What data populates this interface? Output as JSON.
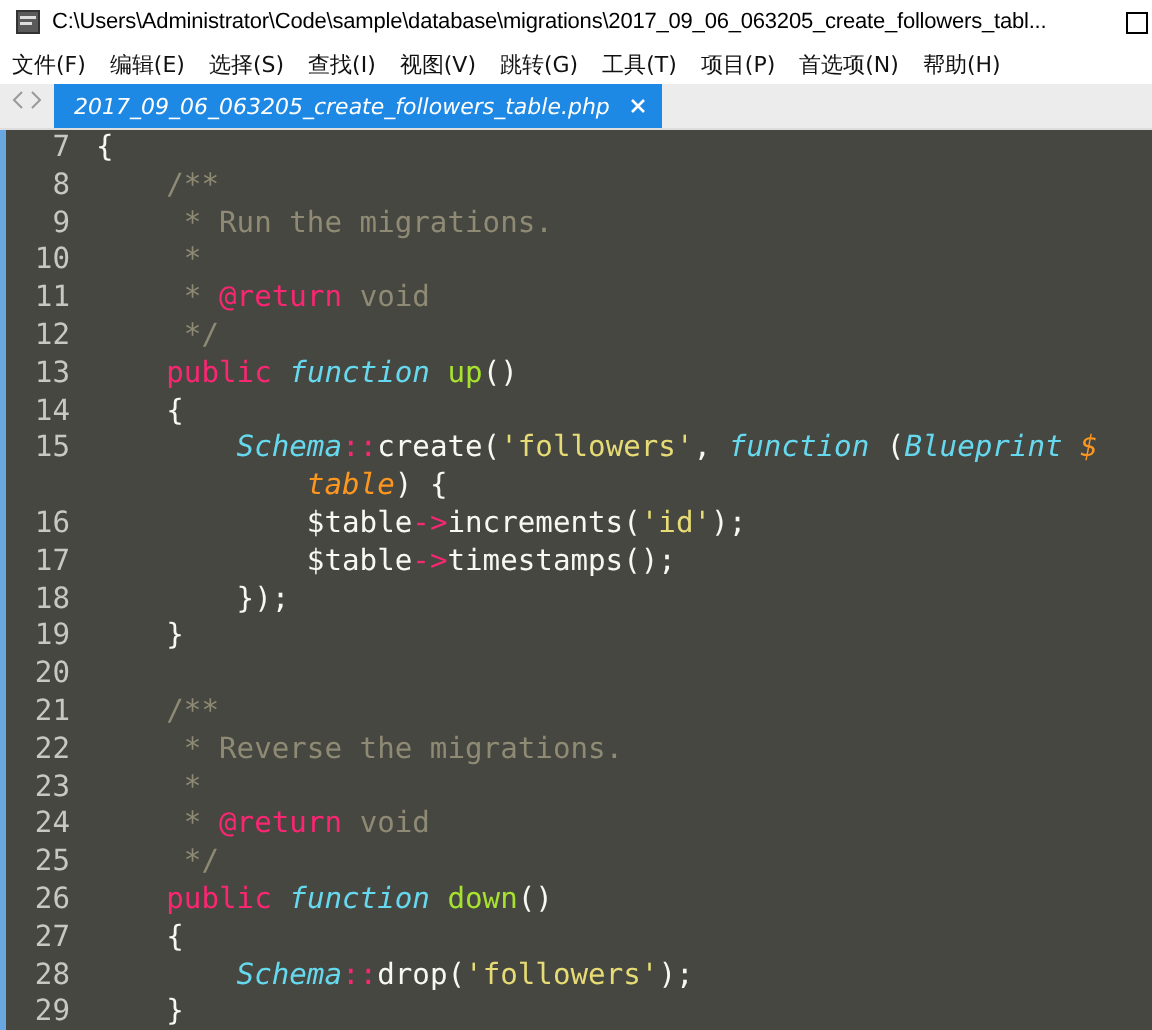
{
  "window": {
    "title": "C:\\Users\\Administrator\\Code\\sample\\database\\migrations\\2017_09_06_063205_create_followers_tabl..."
  },
  "menu": [
    "文件(F)",
    "编辑(E)",
    "选择(S)",
    "查找(I)",
    "视图(V)",
    "跳转(G)",
    "工具(T)",
    "项目(P)",
    "首选项(N)",
    "帮助(H)"
  ],
  "tabs": [
    {
      "label": "2017_09_06_063205_create_followers_table.php",
      "selected": true
    }
  ],
  "editor": {
    "lines": [
      {
        "number": "7",
        "tokens": [
          {
            "kind": "plain",
            "text": "{"
          }
        ]
      },
      {
        "number": "8",
        "tokens": [
          {
            "kind": "comment",
            "text": "    /**"
          }
        ]
      },
      {
        "number": "9",
        "tokens": [
          {
            "kind": "comment",
            "text": "     * Run the migrations."
          }
        ]
      },
      {
        "number": "10",
        "tokens": [
          {
            "kind": "comment",
            "text": "     *"
          }
        ]
      },
      {
        "number": "11",
        "tokens": [
          {
            "kind": "comment",
            "text": "     * "
          },
          {
            "kind": "keyword",
            "text": "@return"
          },
          {
            "kind": "comment",
            "text": " void"
          }
        ]
      },
      {
        "number": "12",
        "tokens": [
          {
            "kind": "comment",
            "text": "     */"
          }
        ]
      },
      {
        "number": "13",
        "tokens": [
          {
            "kind": "keyword",
            "text": "    public "
          },
          {
            "kind": "storage",
            "text": "function "
          },
          {
            "kind": "entity",
            "text": "up"
          },
          {
            "kind": "plain",
            "text": "()"
          }
        ]
      },
      {
        "number": "14",
        "tokens": [
          {
            "kind": "plain",
            "text": "    {"
          }
        ]
      },
      {
        "number": "15",
        "tokens": [
          {
            "kind": "storage",
            "text": "        Schema"
          },
          {
            "kind": "keyword",
            "text": "::"
          },
          {
            "kind": "plain",
            "text": "create("
          },
          {
            "kind": "string",
            "text": "'followers'"
          },
          {
            "kind": "plain",
            "text": ", "
          },
          {
            "kind": "storage",
            "text": "function"
          },
          {
            "kind": "plain",
            "text": " ("
          },
          {
            "kind": "storage",
            "text": "Blueprint "
          },
          {
            "kind": "param",
            "text": "$"
          }
        ]
      },
      {
        "tokens": [
          {
            "kind": "param",
            "text": "            table"
          },
          {
            "kind": "plain",
            "text": ") {"
          }
        ]
      },
      {
        "number": "16",
        "tokens": [
          {
            "kind": "plain",
            "text": "            $table"
          },
          {
            "kind": "keyword",
            "text": "->"
          },
          {
            "kind": "plain",
            "text": "increments("
          },
          {
            "kind": "string",
            "text": "'id'"
          },
          {
            "kind": "plain",
            "text": ");"
          }
        ]
      },
      {
        "number": "17",
        "tokens": [
          {
            "kind": "plain",
            "text": "            $table"
          },
          {
            "kind": "keyword",
            "text": "->"
          },
          {
            "kind": "plain",
            "text": "timestamps();"
          }
        ]
      },
      {
        "number": "18",
        "tokens": [
          {
            "kind": "plain",
            "text": "        });"
          }
        ]
      },
      {
        "number": "19",
        "tokens": [
          {
            "kind": "plain",
            "text": "    }"
          }
        ]
      },
      {
        "number": "20"
      },
      {
        "number": "21",
        "tokens": [
          {
            "kind": "comment",
            "text": "    /**"
          }
        ]
      },
      {
        "number": "22",
        "tokens": [
          {
            "kind": "comment",
            "text": "     * Reverse the migrations."
          }
        ]
      },
      {
        "number": "23",
        "tokens": [
          {
            "kind": "comment",
            "text": "     *"
          }
        ]
      },
      {
        "number": "24",
        "tokens": [
          {
            "kind": "comment",
            "text": "     * "
          },
          {
            "kind": "keyword",
            "text": "@return"
          },
          {
            "kind": "comment",
            "text": " void"
          }
        ]
      },
      {
        "number": "25",
        "tokens": [
          {
            "kind": "comment",
            "text": "     */"
          }
        ]
      },
      {
        "number": "26",
        "tokens": [
          {
            "kind": "keyword",
            "text": "    public "
          },
          {
            "kind": "storage",
            "text": "function "
          },
          {
            "kind": "entity",
            "text": "down"
          },
          {
            "kind": "plain",
            "text": "()"
          }
        ]
      },
      {
        "number": "27",
        "tokens": [
          {
            "kind": "plain",
            "text": "    {"
          }
        ]
      },
      {
        "number": "28",
        "tokens": [
          {
            "kind": "storage",
            "text": "        Schema"
          },
          {
            "kind": "keyword",
            "text": "::"
          },
          {
            "kind": "plain",
            "text": "drop("
          },
          {
            "kind": "string",
            "text": "'followers'"
          },
          {
            "kind": "plain",
            "text": ");"
          }
        ]
      },
      {
        "number": "29",
        "tokens": [
          {
            "kind": "plain",
            "text": "    }"
          }
        ]
      }
    ]
  }
}
